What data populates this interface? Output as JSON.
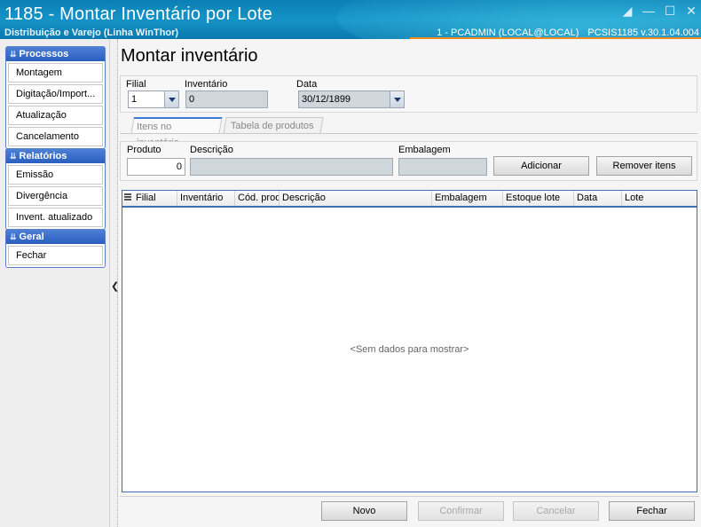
{
  "window": {
    "title": "1185 - Montar Inventário por Lote",
    "subtitle": "Distribuição e Varejo (Linha WinThor)",
    "user_info": "1 - PCADMIN (LOCAL@LOCAL)",
    "version_info": "PCSIS1185  v.30.1.04.004",
    "accent_color": "#1593c6",
    "orange_accent": "#f08a1a"
  },
  "sidebar": {
    "groups": [
      {
        "title": "Processos",
        "items": [
          "Montagem",
          "Digitação/Import...",
          "Atualização",
          "Cancelamento"
        ]
      },
      {
        "title": "Relatórios",
        "items": [
          "Emissão",
          "Divergência",
          "Invent. atualizado"
        ]
      },
      {
        "title": "Geral",
        "items": [
          "Fechar"
        ]
      }
    ]
  },
  "main": {
    "title": "Montar inventário",
    "filters": {
      "filial_label": "Filial",
      "filial_value": "1",
      "inventario_label": "Inventário",
      "inventario_value": "0",
      "data_label": "Data",
      "data_value": "30/12/1899"
    },
    "tabs": [
      "Itens no inventário",
      "Tabela de produtos"
    ],
    "item_form": {
      "produto_label": "Produto",
      "produto_value": "0",
      "descricao_label": "Descrição",
      "descricao_value": "",
      "embalagem_label": "Embalagem",
      "embalagem_value": "",
      "add_button": "Adicionar",
      "remove_button": "Remover itens"
    },
    "grid": {
      "columns": [
        "Filial",
        "Inventário",
        "Cód. prod",
        "Descrição",
        "Embalagem",
        "Estoque lote",
        "Data",
        "Lote"
      ],
      "empty_message": "<Sem dados para mostrar>"
    },
    "footer": {
      "novo": "Novo",
      "confirmar": "Confirmar",
      "cancelar": "Cancelar",
      "fechar": "Fechar"
    }
  }
}
